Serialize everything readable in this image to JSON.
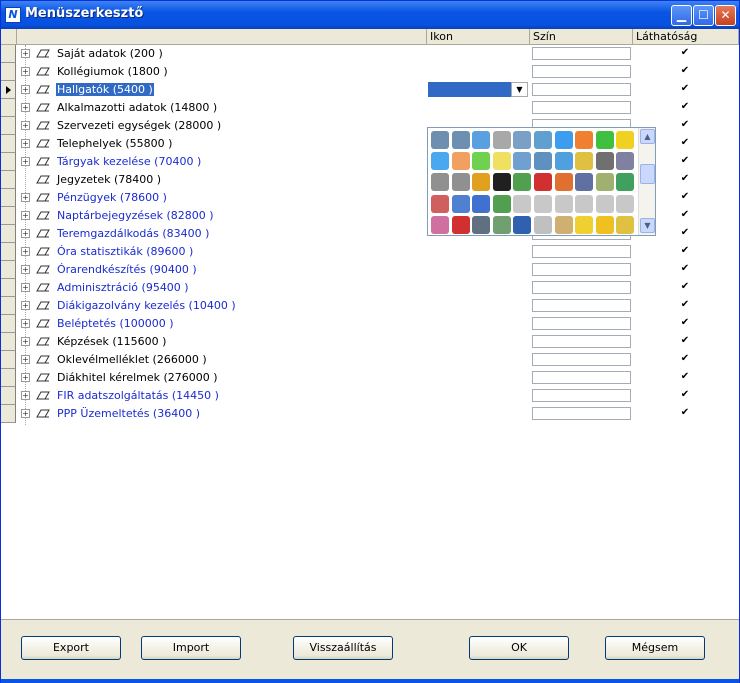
{
  "window": {
    "title": "Menüszerkesztő",
    "minimize_icon": "minimize-icon",
    "maximize_icon": "maximize-icon",
    "close_icon": "close-icon"
  },
  "grid": {
    "columns": {
      "icon": "Ikon",
      "color": "Szín",
      "visibility": "Láthatóság"
    },
    "rows": [
      {
        "label": "Saját adatok (200  )",
        "blue": false,
        "expandable": true
      },
      {
        "label": "Kollégiumok (1800  )",
        "blue": false,
        "expandable": true
      },
      {
        "label": "Hallgatók (5400  )",
        "blue": false,
        "expandable": true,
        "selected": true
      },
      {
        "label": "Alkalmazotti adatok (14800  )",
        "blue": false,
        "expandable": true
      },
      {
        "label": "Szervezeti egységek (28000  )",
        "blue": false,
        "expandable": true
      },
      {
        "label": "Telephelyek (55800  )",
        "blue": false,
        "expandable": true
      },
      {
        "label": "Tárgyak kezelése (70400  )",
        "blue": true,
        "expandable": true
      },
      {
        "label": "Jegyzetek (78400  )",
        "blue": false,
        "expandable": false
      },
      {
        "label": "Pénzügyek (78600  )",
        "blue": true,
        "expandable": true
      },
      {
        "label": "Naptárbejegyzések (82800  )",
        "blue": true,
        "expandable": true
      },
      {
        "label": "Teremgazdálkodás (83400  )",
        "blue": true,
        "expandable": true
      },
      {
        "label": "Óra statisztikák (89600  )",
        "blue": true,
        "expandable": true
      },
      {
        "label": "Órarendkészítés (90400  )",
        "blue": true,
        "expandable": true
      },
      {
        "label": "Adminisztráció (95400  )",
        "blue": true,
        "expandable": true
      },
      {
        "label": "Diákigazolvány kezelés (10400  )",
        "blue": true,
        "expandable": true
      },
      {
        "label": "Beléptetés (100000  )",
        "blue": true,
        "expandable": true
      },
      {
        "label": "Képzések (115600  )",
        "blue": false,
        "expandable": true
      },
      {
        "label": "Oklevélmelléklet (266000  )",
        "blue": false,
        "expandable": true
      },
      {
        "label": "Diákhitel kérelmek (276000  )",
        "blue": false,
        "expandable": true
      },
      {
        "label": "FIR adatszolgáltatás (14450  )",
        "blue": true,
        "expandable": true
      },
      {
        "label": "PPP Üzemeltetés (36400  )",
        "blue": true,
        "expandable": true
      }
    ],
    "visible_checkmark": "✔"
  },
  "palette": {
    "icons": [
      [
        "tools-icon",
        "tools-icon",
        "gear-icon",
        "gear-icon",
        "printer-icon",
        "printer-icon",
        "plus-blue-icon",
        "plus-orange-icon",
        "plus-green-icon",
        "plus-yellow-icon"
      ],
      [
        "minus-blue-icon",
        "minus-orange-icon",
        "minus-green-icon",
        "minus-yellow-icon",
        "list-add-icon",
        "list-add-icon",
        "hierarchy-icon",
        "hierarchy-icon",
        "anchor-icon",
        "list-icon"
      ],
      [
        "paperclip-icon",
        "paperclip-icon",
        "medal-icon",
        "bomb-icon",
        "book-icon",
        "bookmark-icon",
        "cake-icon",
        "camera-icon",
        "car-icon",
        "org-chart-icon"
      ],
      [
        "pie-chart-icon",
        "grid-icon",
        "speech-bubble-icon",
        "pushpin-icon",
        "play-back-icon",
        "fast-forward-icon",
        "play-icon",
        "rewind-icon",
        "step-back-icon",
        "stop-icon"
      ],
      [
        "color-wheel-icon",
        "delete-icon",
        "scissors-icon",
        "calendar-icon",
        "floppy-icon",
        "envelope-icon",
        "open-envelope-icon",
        "smiley-icon",
        "grin-icon",
        "sad-icon"
      ]
    ],
    "colors": [
      [
        "#6d8fb0",
        "#6d8fb0",
        "#5aa0e0",
        "#a8a8a8",
        "#7aa0c8",
        "#60a0d0",
        "#3c9cf0",
        "#f08030",
        "#40c040",
        "#f0d020"
      ],
      [
        "#4aa8f0",
        "#f0a060",
        "#70d050",
        "#f0e060",
        "#70a0d0",
        "#6090c0",
        "#50a0e0",
        "#e0c040",
        "#707070",
        "#8080a0"
      ],
      [
        "#909090",
        "#909090",
        "#e0a020",
        "#202020",
        "#50a050",
        "#d03030",
        "#e07030",
        "#6070a0",
        "#a0b070",
        "#40a060"
      ],
      [
        "#d06060",
        "#5080d0",
        "#4070d0",
        "#50a050",
        "#c8c8c8",
        "#c8c8c8",
        "#c8c8c8",
        "#c8c8c8",
        "#c8c8c8",
        "#c8c8c8"
      ],
      [
        "#d070a0",
        "#d03030",
        "#607080",
        "#70a070",
        "#3060b0",
        "#c0c0c0",
        "#d0b070",
        "#f0d030",
        "#f0c020",
        "#e0c040"
      ]
    ]
  },
  "footer": {
    "export": "Export",
    "import": "Import",
    "restore": "Visszaállítás",
    "ok": "OK",
    "cancel": "Mégsem"
  }
}
